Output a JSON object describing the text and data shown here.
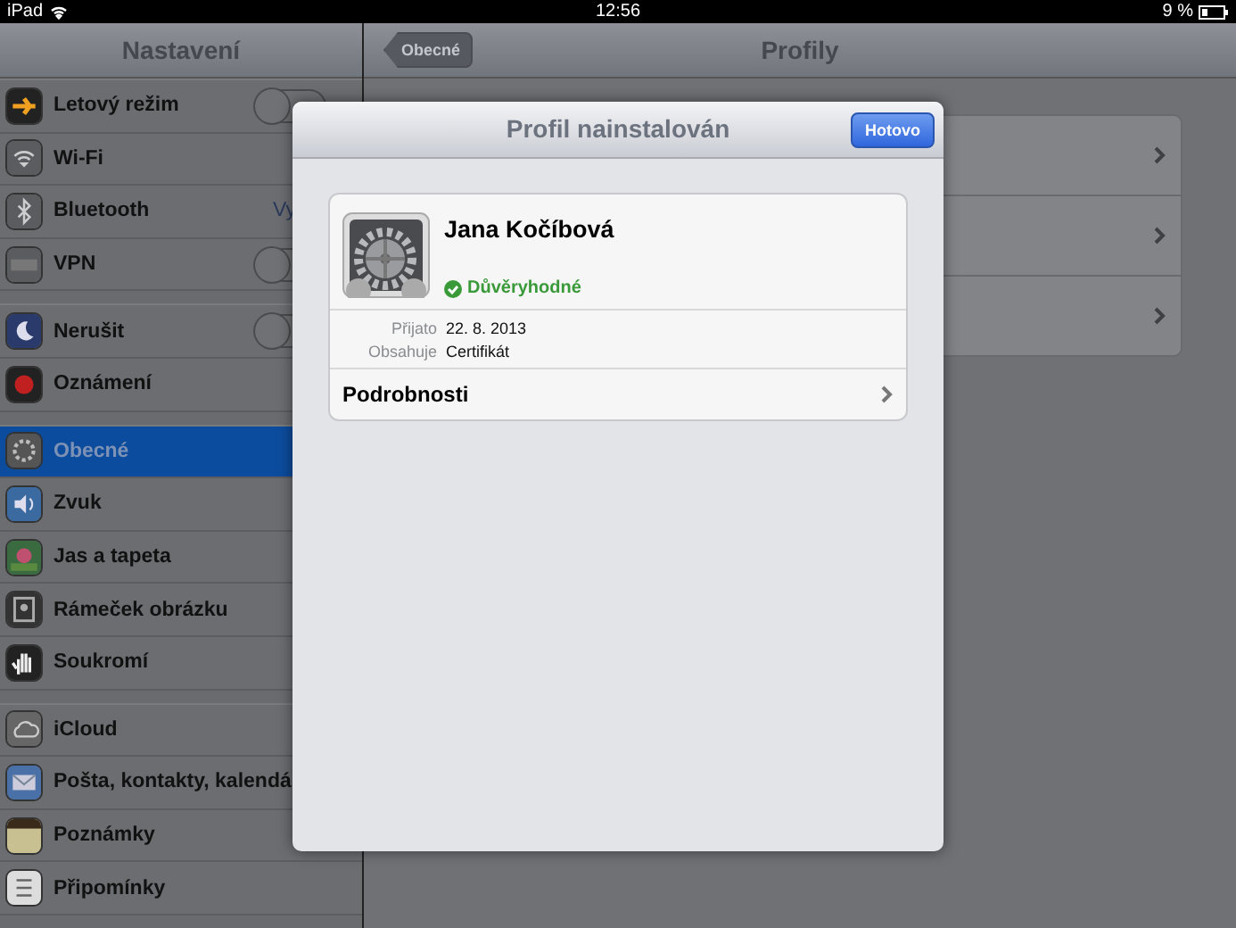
{
  "status_bar": {
    "device": "iPad",
    "time": "12:56",
    "battery": "9 %"
  },
  "sidebar": {
    "title": "Nastavení",
    "groups": [
      {
        "items": [
          {
            "label": "Letový režim",
            "kind": "switch",
            "on": false,
            "selected": false
          },
          {
            "label": "Wi-Fi",
            "kind": "link",
            "selected": false
          },
          {
            "label": "Bluetooth",
            "kind": "value",
            "value": "Vy",
            "selected": false
          },
          {
            "label": "VPN",
            "kind": "switch",
            "on": false,
            "selected": false
          }
        ]
      },
      {
        "items": [
          {
            "label": "Nerušit",
            "kind": "switch",
            "on": false,
            "selected": false
          },
          {
            "label": "Oznámení",
            "kind": "link",
            "selected": false
          }
        ]
      },
      {
        "items": [
          {
            "label": "Obecné",
            "kind": "link",
            "selected": true
          },
          {
            "label": "Zvuk",
            "kind": "link",
            "selected": false
          },
          {
            "label": "Jas a tapeta",
            "kind": "link",
            "selected": false
          },
          {
            "label": "Rámeček obrázku",
            "kind": "link",
            "selected": false
          },
          {
            "label": "Soukromí",
            "kind": "link",
            "selected": false
          }
        ]
      },
      {
        "items": [
          {
            "label": "iCloud",
            "kind": "link",
            "selected": false
          },
          {
            "label": "Pošta, kontakty, kalendá",
            "kind": "link",
            "selected": false
          },
          {
            "label": "Poznámky",
            "kind": "link",
            "selected": false
          },
          {
            "label": "Připomínky",
            "kind": "link",
            "selected": false
          }
        ]
      }
    ]
  },
  "detail": {
    "back": "Obecné",
    "title": "Profily"
  },
  "modal": {
    "title": "Profil nainstalován",
    "done": "Hotovo",
    "profile": {
      "name": "Jana Kočíbová",
      "status": "Důvěryhodné",
      "verified": true
    },
    "fields": [
      {
        "label": "Přijato",
        "value": "22. 8. 2013"
      },
      {
        "label": "Obsahuje",
        "value": "Certifikát"
      }
    ],
    "more": "Podrobnosti"
  }
}
